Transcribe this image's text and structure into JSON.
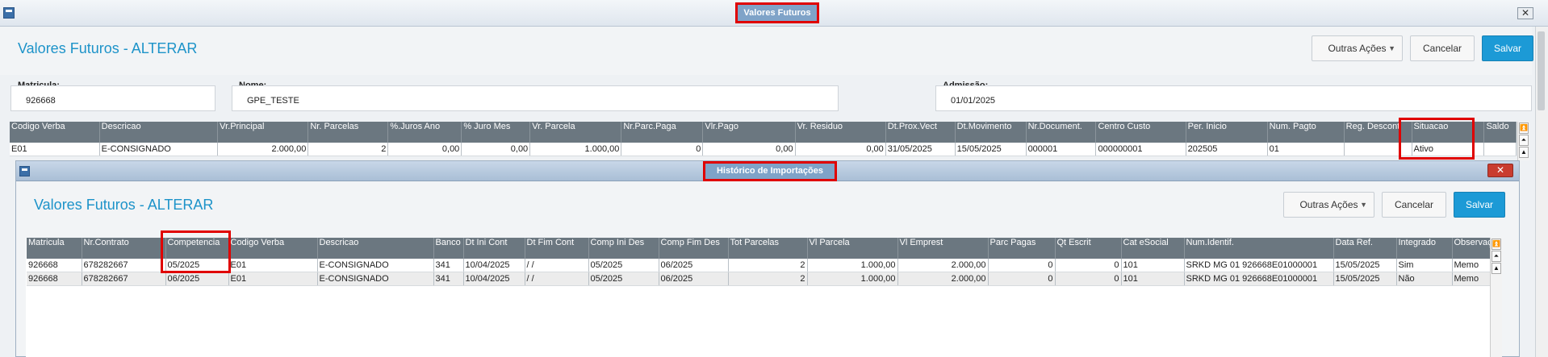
{
  "window": {
    "title": "Valores Futuros",
    "close_glyph": "✕"
  },
  "header": {
    "title": "Valores Futuros - ALTERAR"
  },
  "actions": {
    "outras_acoes": "Outras Ações",
    "cancelar": "Cancelar",
    "salvar": "Salvar"
  },
  "fields": {
    "matricula": {
      "label": "Matricula:",
      "value": "926668"
    },
    "nome": {
      "label": "Nome:",
      "value": "GPE_TESTE"
    },
    "admissao": {
      "label": "Admissão:",
      "value": "01/01/2025"
    }
  },
  "main_grid": {
    "columns": [
      "Codigo Verba",
      "Descricao",
      "Vr.Principal",
      "Nr. Parcelas",
      "%.Juros Ano",
      "% Juro Mes",
      "Vr. Parcela",
      "Nr.Parc.Paga",
      "Vlr.Pago",
      "Vr. Residuo",
      "Dt.Prox.Vect",
      "Dt.Movimento",
      "Nr.Document.",
      "Centro Custo",
      "Per. Inicio",
      "Num. Pagto",
      "Reg. Descont",
      "Situacao",
      "Saldo"
    ],
    "rows": [
      [
        "E01",
        "E-CONSIGNADO",
        "2.000,00",
        "2",
        "0,00",
        "0,00",
        "1.000,00",
        "0",
        "0,00",
        "0,00",
        "31/05/2025",
        "15/05/2025",
        "000001",
        "000000001",
        "202505",
        "01",
        "",
        "Ativo",
        ""
      ]
    ]
  },
  "dialog": {
    "title": "Histórico de Importações",
    "close_glyph": "✕",
    "header_title": "Valores Futuros - ALTERAR",
    "actions": {
      "outras_acoes": "Outras Ações",
      "cancelar": "Cancelar",
      "salvar": "Salvar"
    },
    "grid": {
      "columns": [
        "Matricula",
        "Nr.Contrato",
        "Competencia",
        "Codigo Verba",
        "Descricao",
        "Banco",
        "Dt Ini Cont",
        "Dt Fim Cont",
        "Comp Ini Des",
        "Comp Fim Des",
        "Tot Parcelas",
        "Vl Parcela",
        "Vl Emprest",
        "Parc Pagas",
        "Qt Escrit",
        "Cat eSocial",
        "Num.Identif.",
        "Data Ref.",
        "Integrado",
        "Observação"
      ],
      "rows": [
        [
          "926668",
          "678282667",
          "05/2025",
          "E01",
          "E-CONSIGNADO",
          "341",
          "10/04/2025",
          "  /  /",
          "05/2025",
          "06/2025",
          "2",
          "1.000,00",
          "2.000,00",
          "0",
          "0",
          "101",
          "SRKD MG 01 926668E01000001",
          "15/05/2025",
          "Sim",
          "Memo"
        ],
        [
          "926668",
          "678282667",
          "06/2025",
          "E01",
          "E-CONSIGNADO",
          "341",
          "10/04/2025",
          "  /  /",
          "05/2025",
          "06/2025",
          "2",
          "1.000,00",
          "2.000,00",
          "0",
          "0",
          "101",
          "SRKD MG 01 926668E01000001",
          "15/05/2025",
          "Não",
          "Memo"
        ]
      ]
    }
  },
  "scroll_glyphs": {
    "top": "⏫",
    "up": "⏶",
    "page_up": "▲"
  }
}
